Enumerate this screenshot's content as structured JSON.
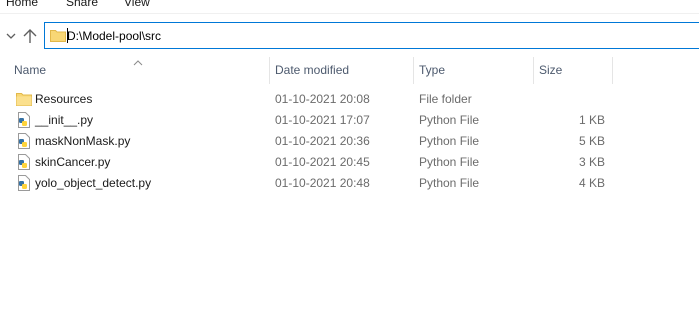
{
  "ribbon": {
    "tabs": [
      {
        "label": "Home"
      },
      {
        "label": "Share"
      },
      {
        "label": "View"
      }
    ]
  },
  "navigation": {
    "back_dropdown_icon": "chevron-down-icon",
    "up_icon": "arrow-up-icon"
  },
  "address_bar": {
    "path": "D:\\Model-pool\\src",
    "icon": "folder-icon"
  },
  "columns": [
    {
      "label": "Name",
      "sorted": "ascending"
    },
    {
      "label": "Date modified"
    },
    {
      "label": "Type"
    },
    {
      "label": "Size"
    }
  ],
  "files": [
    {
      "name": "Resources",
      "date": "01-10-2021 20:08",
      "type": "File folder",
      "size": "",
      "icon": "folder-icon"
    },
    {
      "name": "__init__.py",
      "date": "01-10-2021 17:07",
      "type": "Python File",
      "size": "1 KB",
      "icon": "python-file-icon"
    },
    {
      "name": "maskNonMask.py",
      "date": "01-10-2021 20:36",
      "type": "Python File",
      "size": "5 KB",
      "icon": "python-file-icon"
    },
    {
      "name": "skinCancer.py",
      "date": "01-10-2021 20:45",
      "type": "Python File",
      "size": "3 KB",
      "icon": "python-file-icon"
    },
    {
      "name": "yolo_object_detect.py",
      "date": "01-10-2021 20:48",
      "type": "Python File",
      "size": "4 KB",
      "icon": "python-file-icon"
    }
  ],
  "colors": {
    "accent": "#0078d7",
    "folder": "#f8d775",
    "python_blue": "#3572a5",
    "python_yellow": "#ffd43b"
  }
}
